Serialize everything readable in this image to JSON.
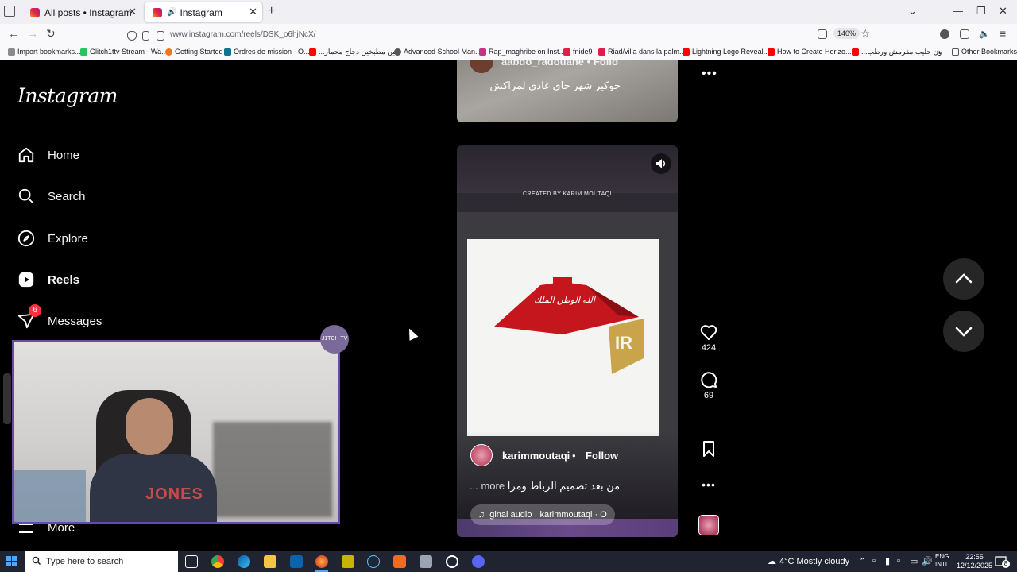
{
  "browser": {
    "tabs": [
      {
        "label": "All posts • Instagram"
      },
      {
        "label": "Instagram"
      }
    ],
    "url": "www.instagram.com/reels/DSK_o6hjNcX/",
    "zoom": "140%",
    "bookmarks": [
      {
        "label": "Import bookmarks...",
        "color": "#8a8a8a"
      },
      {
        "label": "Glitch1ttv Stream - Wa...",
        "color": "#22c55e"
      },
      {
        "label": "Getting Started",
        "color": "#f97316"
      },
      {
        "label": "Ordres de mission - O...",
        "color": "#0e7490"
      },
      {
        "label": "...بين مطبخين دجاج محمار",
        "color": "#ff0000"
      },
      {
        "label": "Advanced School Man...",
        "color": "#555"
      },
      {
        "label": "Rap_maghribe on Inst...",
        "color": "#c13584"
      },
      {
        "label": "fnide9",
        "color": "#e11d48"
      },
      {
        "label": "Riad/villa dans la palm...",
        "color": "#e11d48"
      },
      {
        "label": "Lightning Logo Reveal...",
        "color": "#ff0000"
      },
      {
        "label": "How to Create Horizo...",
        "color": "#ff0000"
      },
      {
        "label": "...ون حليب مقرمش ورطب",
        "color": "#ff0000"
      },
      {
        "label": "Other Bookmarks",
        "color": "#555"
      }
    ]
  },
  "sidebar": {
    "logo": "Instagram",
    "items": [
      {
        "label": "Home",
        "icon": "home-icon"
      },
      {
        "label": "Search",
        "icon": "search-icon"
      },
      {
        "label": "Explore",
        "icon": "compass-icon"
      },
      {
        "label": "Reels",
        "icon": "reels-icon"
      },
      {
        "label": "Messages",
        "icon": "messenger-icon",
        "badge": "6"
      }
    ],
    "more_label": "More"
  },
  "feed": {
    "previous_post": {
      "username": "aabdo_radouane",
      "follow_label": "Follo",
      "caption": "جوكير شهر جاي غادي لمراكش"
    },
    "reel": {
      "credit_text": "CREATED BY KARIM MOUTAQI",
      "artboard_text": "الله الوطن الملك",
      "artboard_logo": "IR",
      "username": "karimmoutaqi",
      "separator": "•",
      "follow_label": "Follow",
      "caption": "من بعد تصميم الرباط ومرا",
      "caption_more": "... more",
      "audio_label": "ginal audio",
      "audio_artist": "karimmoutaqi · O"
    },
    "actions": {
      "likes": "424",
      "comments": "69"
    }
  },
  "webcam": {
    "shirt_text": "JONES",
    "tag_text": "J1TCH TV"
  },
  "taskbar": {
    "search_placeholder": "Type here to search",
    "weather": "4°C  Mostly cloudy",
    "lang_line1": "ENG",
    "lang_line2": "INTL",
    "time": "22:55",
    "date": "12/12/2025",
    "notification_count": "8"
  },
  "colors": {
    "instagram_bg": "#000000",
    "like_badge": "#ff3040",
    "webcam_border": "#6a4aa8",
    "taskbar_bg": "#202330"
  }
}
